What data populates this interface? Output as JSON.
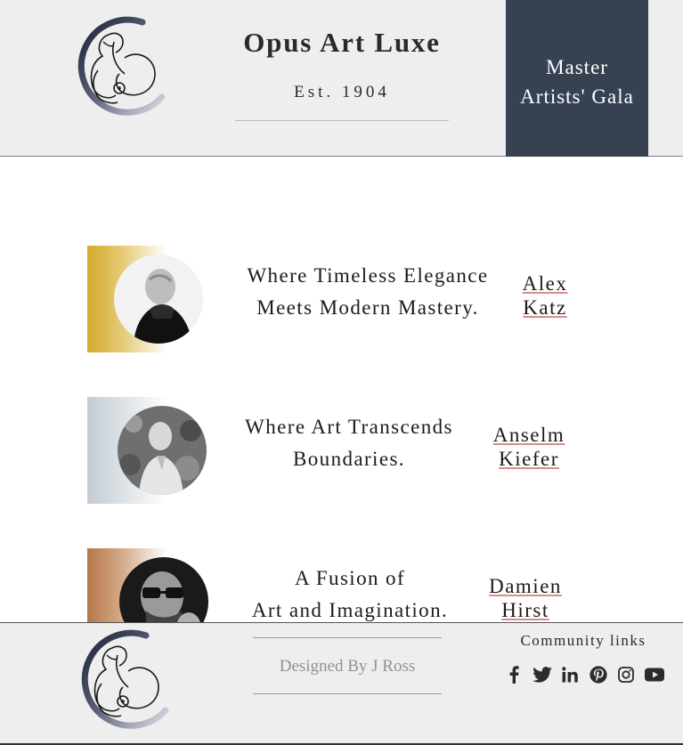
{
  "header": {
    "title": "Opus Art Luxe",
    "established": "Est. 1904",
    "gala_line1": "Master",
    "gala_line2": "Artists' Gala"
  },
  "rows": [
    {
      "tagline_line1": "Where Timeless Elegance",
      "tagline_line2": "Meets Modern Mastery.",
      "artist_first": "Alex",
      "artist_last": "Katz",
      "accent_color": "#d4aa2a"
    },
    {
      "tagline_line1": "Where Art Transcends",
      "tagline_line2": "Boundaries.",
      "artist_first": "Anselm",
      "artist_last": "Kiefer",
      "accent_color": "#c4ccd3"
    },
    {
      "tagline_line1": "A Fusion of",
      "tagline_line2": "Art and Imagination.",
      "artist_first": "Damien",
      "artist_last": "Hirst",
      "accent_color": "#b5764a"
    }
  ],
  "footer": {
    "designed_by": "Designed By J Ross",
    "community_label": "Community links",
    "social_icons": [
      "facebook-icon",
      "twitter-icon",
      "linkedin-icon",
      "pinterest-icon",
      "instagram-icon",
      "youtube-icon"
    ]
  },
  "colors": {
    "header_bg": "#eeeeee",
    "gala_bg": "#364152",
    "link_underline": "#d98d8d"
  }
}
